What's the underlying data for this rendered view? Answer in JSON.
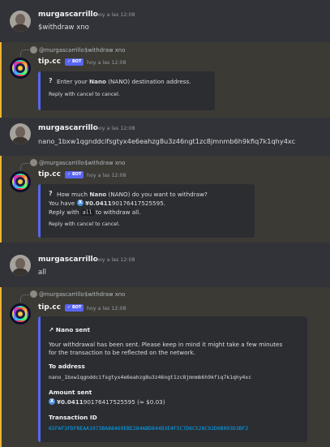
{
  "messages": {
    "m1": {
      "user": "murgascarrillo",
      "time": "hoy a las 12:08",
      "text": "$withdraw xno"
    },
    "m2": {
      "reply_user": "@murgascarrillo",
      "reply_text": "$withdraw xno",
      "user": "tip.cc",
      "badge": "BOT",
      "time": "hoy a las 12:08",
      "embed": {
        "pre": "Enter your ",
        "bold": "Nano",
        "post": " (NANO) destination address.",
        "footer": "Reply with cancel to cancel."
      }
    },
    "m3": {
      "user": "murgascarrillo",
      "time": "hoy a las 12:08",
      "text": "nano_1bxw1qgnddcifsgtyx4e6eahzg8u3z46ngt1zc8jmnmb6h9kfiq7k1qhy4xc"
    },
    "m4": {
      "reply_user": "@murgascarrillo",
      "reply_text": "$withdraw xno",
      "user": "tip.cc",
      "badge": "BOT",
      "time": "hoy a las 12:08",
      "embed": {
        "pre": "How much ",
        "bold": "Nano",
        "post": " (NANO) do you want to withdraw?",
        "have_pre": "You have ",
        "have_bold": "¥0.0411",
        "have_rest": "90176417525595.",
        "reply_pre": "Reply with ",
        "reply_code": "all",
        "reply_post": " to withdraw all.",
        "footer": "Reply with cancel to cancel."
      }
    },
    "m5": {
      "user": "murgascarrillo",
      "time": "hoy a las 12:08",
      "text": "all"
    },
    "m6": {
      "reply_user": "@murgascarrillo",
      "reply_text": "$withdraw xno",
      "user": "tip.cc",
      "badge": "BOT",
      "time": "hoy a las 12:08",
      "embed": {
        "title": "Nano sent",
        "desc1": "Your withdrawal has been sent. Please keep in mind it might take a few minutes",
        "desc2": "for the transaction to be reflected on the network.",
        "to_label": "To address",
        "to_value": "nano_1bxw1qgnddcifsgtyx4e6eahzg8u3z46ngt1zc8jmnmb6h9kfiq7k1qhy4xc",
        "amount_label": "Amount sent",
        "amount_bold": "¥0.0411",
        "amount_rest": "90176417525595",
        "amount_usd": " (≈ $0.03)",
        "tx_label": "Transaction ID",
        "tx_value": "65FAF3FDFBEAA1973BA88469EBE284ABD844D3E4F5C7D6C528C02D0B093D3BF2"
      }
    }
  },
  "colors": {
    "accent": "#5865f2",
    "highlight_bar": "#f0b232",
    "link": "#00a8fc",
    "xno": "#4a90e2"
  }
}
